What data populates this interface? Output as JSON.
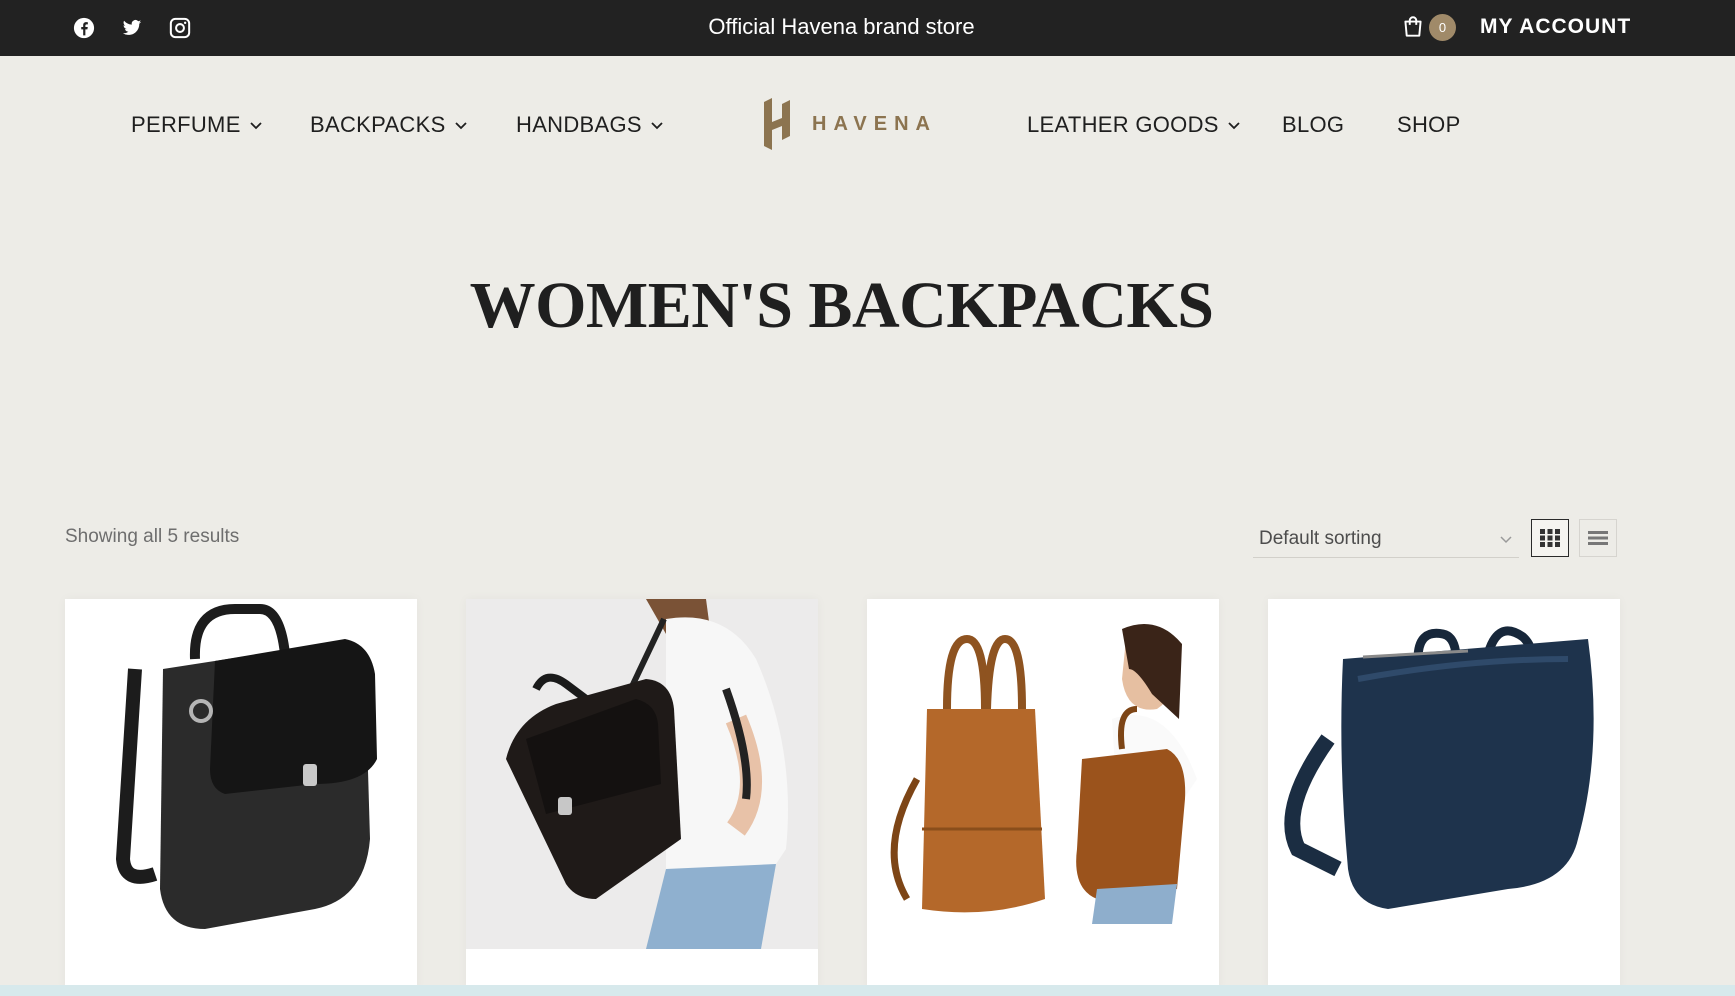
{
  "topbar": {
    "social": [
      {
        "icon": "facebook-icon"
      },
      {
        "icon": "twitter-icon"
      },
      {
        "icon": "instagram-icon"
      }
    ],
    "tagline": "Official Havena brand store",
    "cart_count": "0",
    "account_label": "MY ACCOUNT"
  },
  "nav": {
    "items": [
      {
        "label": "PERFUME",
        "has_dropdown": true
      },
      {
        "label": "BACKPACKS",
        "has_dropdown": true
      },
      {
        "label": "HANDBAGS",
        "has_dropdown": true
      },
      {
        "label": "LEATHER GOODS",
        "has_dropdown": true
      },
      {
        "label": "BLOG",
        "has_dropdown": false
      },
      {
        "label": "SHOP",
        "has_dropdown": false
      }
    ],
    "logo_text": "HAVENA"
  },
  "page": {
    "title": "WOMEN'S BACKPACKS"
  },
  "toolbar": {
    "results_text": "Showing all 5 results",
    "sorting_selected": "Default sorting",
    "view_modes": [
      "grid-view-icon",
      "list-view-icon"
    ],
    "active_view": "grid"
  },
  "products": [
    {
      "image": "black-leather-flap-backpack"
    },
    {
      "image": "woman-wearing-black-backpack"
    },
    {
      "image": "brown-suede-tote-backpack"
    },
    {
      "image": "navy-leather-backpack"
    }
  ],
  "colors": {
    "topbar_bg": "#222222",
    "page_bg": "#edece7",
    "accent": "#a08a69"
  }
}
